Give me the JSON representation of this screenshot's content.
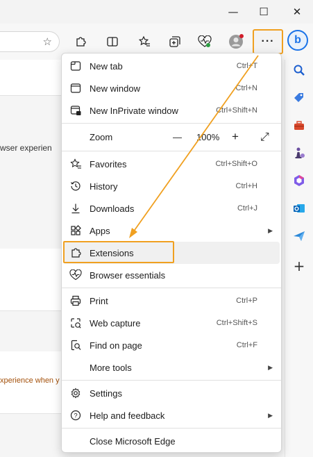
{
  "window": {
    "minimize_glyph": "—",
    "maximize_glyph": "☐",
    "close_glyph": "✕"
  },
  "toolbar": {
    "favorite_star_icon": "star-icon",
    "more_label": "···",
    "bing_label": "b"
  },
  "page": {
    "snippet_1": "wser experien",
    "snippet_2": "xperience when y"
  },
  "menu": {
    "items": [
      {
        "label": "New tab",
        "shortcut": "Ctrl+T",
        "icon": "new-tab-icon"
      },
      {
        "label": "New window",
        "shortcut": "Ctrl+N",
        "icon": "new-window-icon"
      },
      {
        "label": "New InPrivate window",
        "shortcut": "Ctrl+Shift+N",
        "icon": "inprivate-icon"
      },
      {
        "label": "Zoom",
        "icon": "none"
      },
      {
        "label": "Favorites",
        "shortcut": "Ctrl+Shift+O",
        "icon": "favorites-icon"
      },
      {
        "label": "History",
        "shortcut": "Ctrl+H",
        "icon": "history-icon"
      },
      {
        "label": "Downloads",
        "shortcut": "Ctrl+J",
        "icon": "downloads-icon"
      },
      {
        "label": "Apps",
        "shortcut": "",
        "icon": "apps-icon"
      },
      {
        "label": "Extensions",
        "shortcut": "",
        "icon": "extensions-icon"
      },
      {
        "label": "Browser essentials",
        "shortcut": "",
        "icon": "heartbeat-icon"
      },
      {
        "label": "Print",
        "shortcut": "Ctrl+P",
        "icon": "print-icon"
      },
      {
        "label": "Web capture",
        "shortcut": "Ctrl+Shift+S",
        "icon": "web-capture-icon"
      },
      {
        "label": "Find on page",
        "shortcut": "Ctrl+F",
        "icon": "find-icon"
      },
      {
        "label": "More tools",
        "shortcut": "",
        "icon": "none"
      },
      {
        "label": "Settings",
        "shortcut": "",
        "icon": "settings-icon"
      },
      {
        "label": "Help and feedback",
        "shortcut": "",
        "icon": "help-icon"
      },
      {
        "label": "Close Microsoft Edge",
        "shortcut": "",
        "icon": "none"
      }
    ],
    "zoom": {
      "minus": "—",
      "value": "100%",
      "plus": "+",
      "fullscreen": "⤢"
    }
  },
  "colors": {
    "highlight": "#f0a020",
    "accent": "#1a73e8"
  }
}
